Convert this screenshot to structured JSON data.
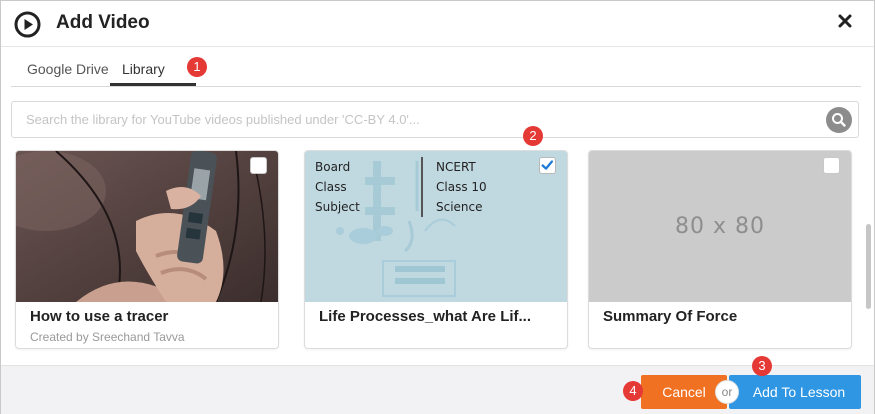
{
  "dialog": {
    "title": "Add Video",
    "icons": {
      "play": "play-circle-icon",
      "close": "close-icon",
      "search": "search-icon",
      "check": "checkmark-icon"
    }
  },
  "tabs": [
    {
      "label": "Google Drive",
      "active": false
    },
    {
      "label": "Library",
      "active": true
    }
  ],
  "badges": [
    "1",
    "2",
    "3",
    "4"
  ],
  "search": {
    "placeholder": "Search the library for YouTube videos published under 'CC-BY 4.0'..."
  },
  "cards": [
    {
      "title": "How to use a tracer",
      "subtitle": "Created by Sreechand Tavva",
      "checked": false
    },
    {
      "title": "Life Processes_what Are Lif...",
      "checked": true,
      "thumb_labels": [
        "Board",
        "Class",
        "Subject"
      ],
      "thumb_values": [
        "NCERT",
        "Class 10",
        "Science"
      ]
    },
    {
      "title": "Summary Of Force",
      "checked": false,
      "thumb_text": "80 x 80"
    }
  ],
  "footer": {
    "cancel": "Cancel",
    "or": "or",
    "add": "Add To Lesson"
  },
  "colors": {
    "cancel": "#f07122",
    "add": "#2f96e3",
    "badge": "#e53935",
    "checkbox": "#1e7bd8"
  }
}
